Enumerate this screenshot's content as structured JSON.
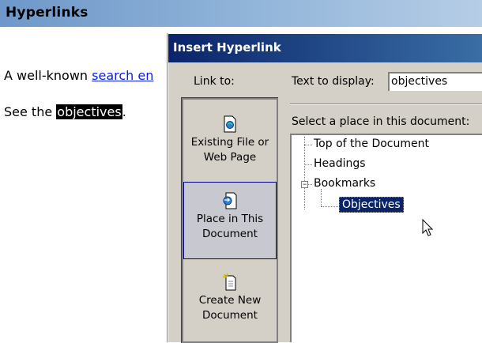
{
  "document": {
    "heading": "Hyperlinks",
    "line1_prefix": "A well-known ",
    "line1_link": "search en",
    "line2_prefix": "See the ",
    "line2_selected": "objectives",
    "line2_suffix": "."
  },
  "dialog": {
    "title": "Insert Hyperlink",
    "link_to_label": "Link to:",
    "link_bar": [
      {
        "line1": "Existing File or",
        "line2": "Web Page",
        "icon": "web-page-icon"
      },
      {
        "line1": "Place in This",
        "line2": "Document",
        "icon": "place-in-document-icon",
        "selected": true
      },
      {
        "line1": "Create New",
        "line2": "Document",
        "icon": "new-document-icon"
      }
    ],
    "text_to_display_label": "Text to display:",
    "text_to_display_value": "objectives",
    "select_place_label": "Select a place in this document:",
    "tree": {
      "top": "Top of the Document",
      "headings": "Headings",
      "bookmarks": "Bookmarks",
      "bookmark_selected": "Objectives"
    }
  },
  "colors": {
    "header_bar": "#6e98c9",
    "titlebar": "#0a246a",
    "selection": "#0a246a",
    "link": "#0b1fe0"
  }
}
